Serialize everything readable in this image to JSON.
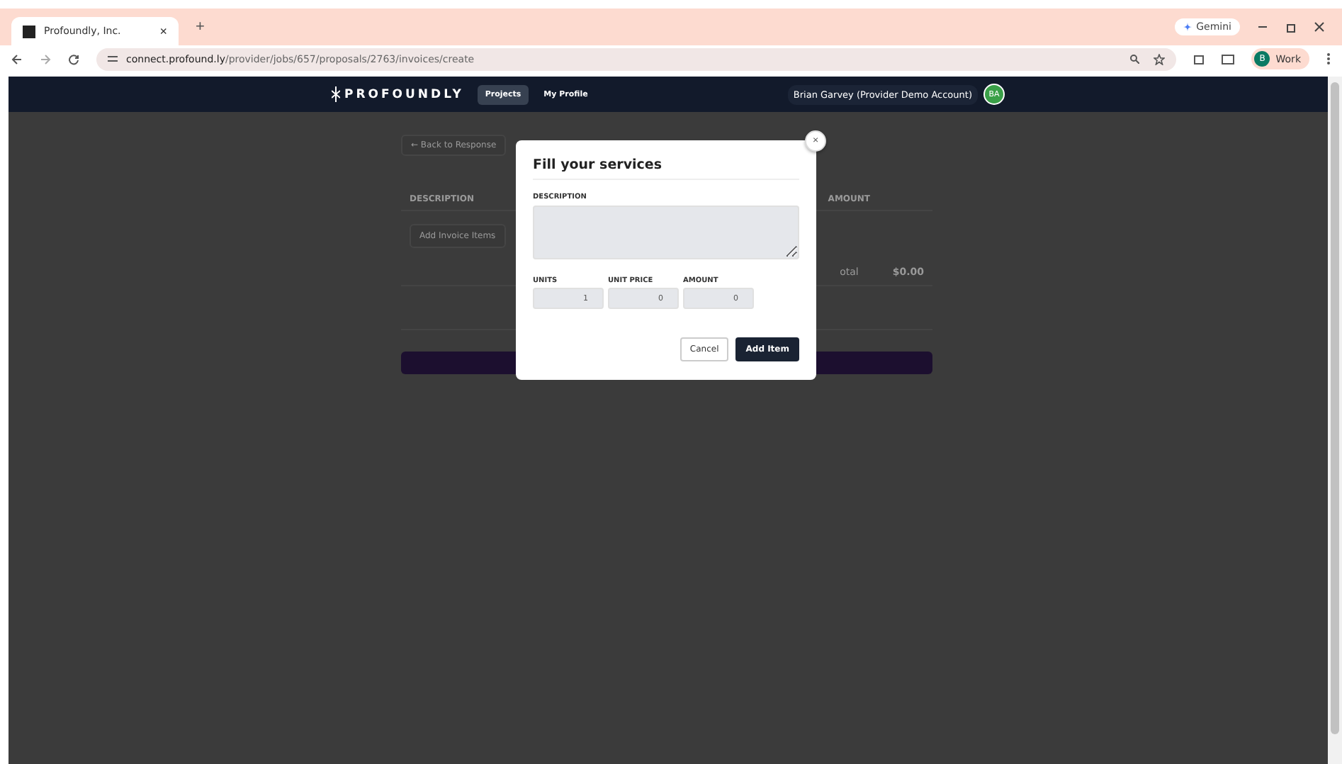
{
  "browser": {
    "tab_title": "Profoundly, Inc.",
    "tab_close": "×",
    "new_tab": "+",
    "url_host": "connect.profound.ly",
    "url_path": "/provider/jobs/657/proposals/2763/invoices/create",
    "gemini": "Gemini",
    "profile_initial": "B",
    "profile_label": "Work"
  },
  "header": {
    "logo": "PROFOUNDLY",
    "nav": [
      {
        "label": "Projects",
        "selected": true
      },
      {
        "label": "My Profile",
        "selected": false
      }
    ],
    "user": "Brian Garvey (Provider Demo Account)",
    "avatar": "BA"
  },
  "page": {
    "back": "← Back to Response",
    "columns": [
      "DESCRIPTION",
      "AMOUNT"
    ],
    "add_items": "Add Invoice Items",
    "total_label": "otal",
    "total_value": "$0.00"
  },
  "modal": {
    "title": "Fill your services",
    "close": "×",
    "description_label": "DESCRIPTION",
    "fields": [
      {
        "label": "UNITS",
        "value": "1"
      },
      {
        "label": "UNIT PRICE",
        "value": "0"
      },
      {
        "label": "AMOUNT",
        "value": "0"
      }
    ],
    "cancel": "Cancel",
    "submit": "Add Item"
  }
}
